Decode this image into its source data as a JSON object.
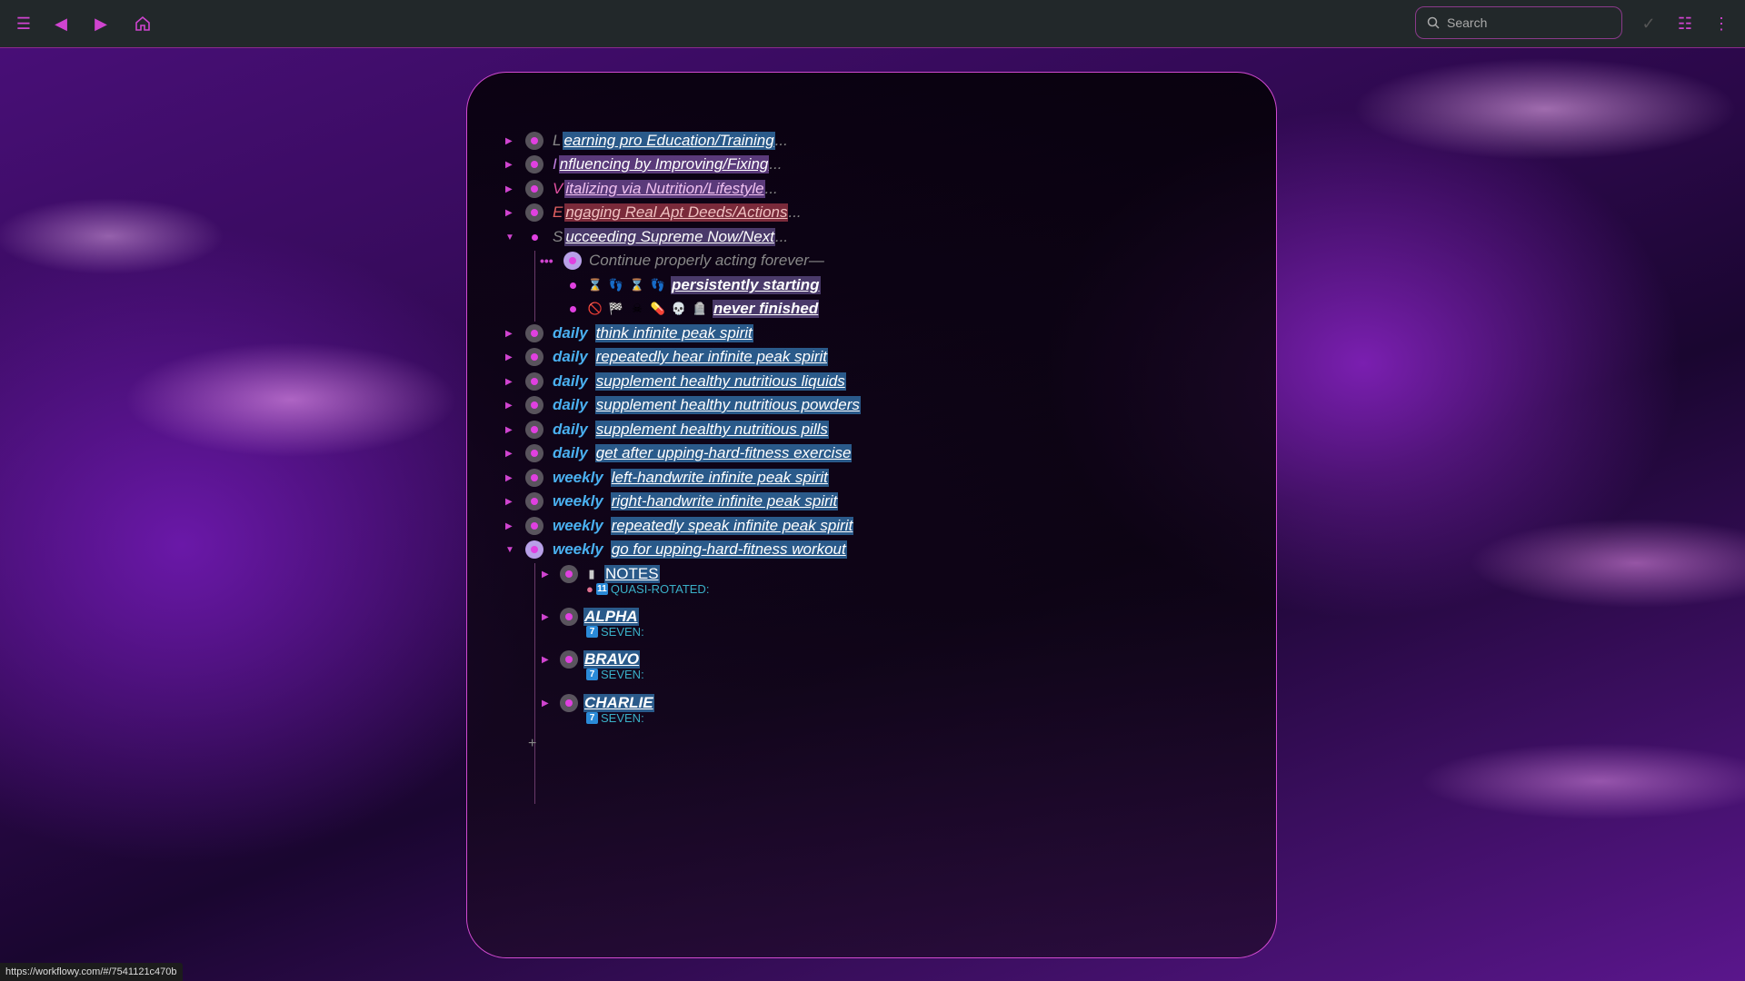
{
  "topbar": {
    "menu_icon": "hamburger-icon",
    "back_icon": "back-icon",
    "forward_icon": "forward-icon",
    "home_icon": "home-icon",
    "search_placeholder": "Search",
    "check_icon": "check-icon",
    "list_icon": "list-icon",
    "more_icon": "more-icon"
  },
  "colors": {
    "accent": "#d044d0",
    "topbar_bg": "#22282a",
    "tag_blue": "#4ab0f0"
  },
  "outline": {
    "top_items": [
      {
        "initial": "L",
        "text": "earning pro Education/Training",
        "suffix": "..."
      },
      {
        "initial": "I",
        "text": "nfluencing by Improving/Fixing",
        "suffix": "..."
      },
      {
        "initial": "V",
        "text": "italizing via Nutrition/Lifestyle",
        "suffix": "..."
      },
      {
        "initial": "E",
        "text": "ngaging Real Apt Deeds/Actions",
        "suffix": "..."
      },
      {
        "initial": "S",
        "text": "ucceeding Supreme Now/Next",
        "suffix": "..."
      }
    ],
    "continue_text": "Continue properly acting forever—",
    "persist": {
      "emoji": [
        "⌛",
        "👣",
        "⌛",
        "👣"
      ],
      "text": "persistently starting"
    },
    "never": {
      "emoji": [
        "🚫",
        "🏁",
        "☠",
        "💊",
        "💀",
        "🪦"
      ],
      "text": "never finished"
    },
    "daily_items": [
      {
        "tag": "daily",
        "text": "think infinite peak spirit"
      },
      {
        "tag": "daily",
        "text": "repeatedly hear infinite peak spirit"
      },
      {
        "tag": "daily",
        "text": "supplement healthy nutritious liquids"
      },
      {
        "tag": "daily",
        "text": "supplement healthy nutritious powders"
      },
      {
        "tag": "daily",
        "text": "supplement healthy nutritious pills"
      },
      {
        "tag": "daily",
        "text": "get after upping-hard-fitness exercise"
      }
    ],
    "weekly_items": [
      {
        "tag": "weekly",
        "text": "left-handwrite infinite peak spirit"
      },
      {
        "tag": "weekly",
        "text": "right-handwrite infinite peak spirit"
      },
      {
        "tag": "weekly",
        "text": "repeatedly speak infinite peak spirit"
      },
      {
        "tag": "weekly",
        "text": "go for upping-hard-fitness workout"
      }
    ],
    "children": [
      {
        "title": "NOTES",
        "note": "QUASI-ROTATED:",
        "note_icon": "11"
      },
      {
        "title": "ALPHA",
        "note": "SEVEN:",
        "note_icon": "7"
      },
      {
        "title": "BRAVO",
        "note": "SEVEN:",
        "note_icon": "7"
      },
      {
        "title": "CHARLIE",
        "note": "SEVEN:",
        "note_icon": "7"
      }
    ]
  },
  "status_url": "https://workflowy.com/#/7541121c470b"
}
